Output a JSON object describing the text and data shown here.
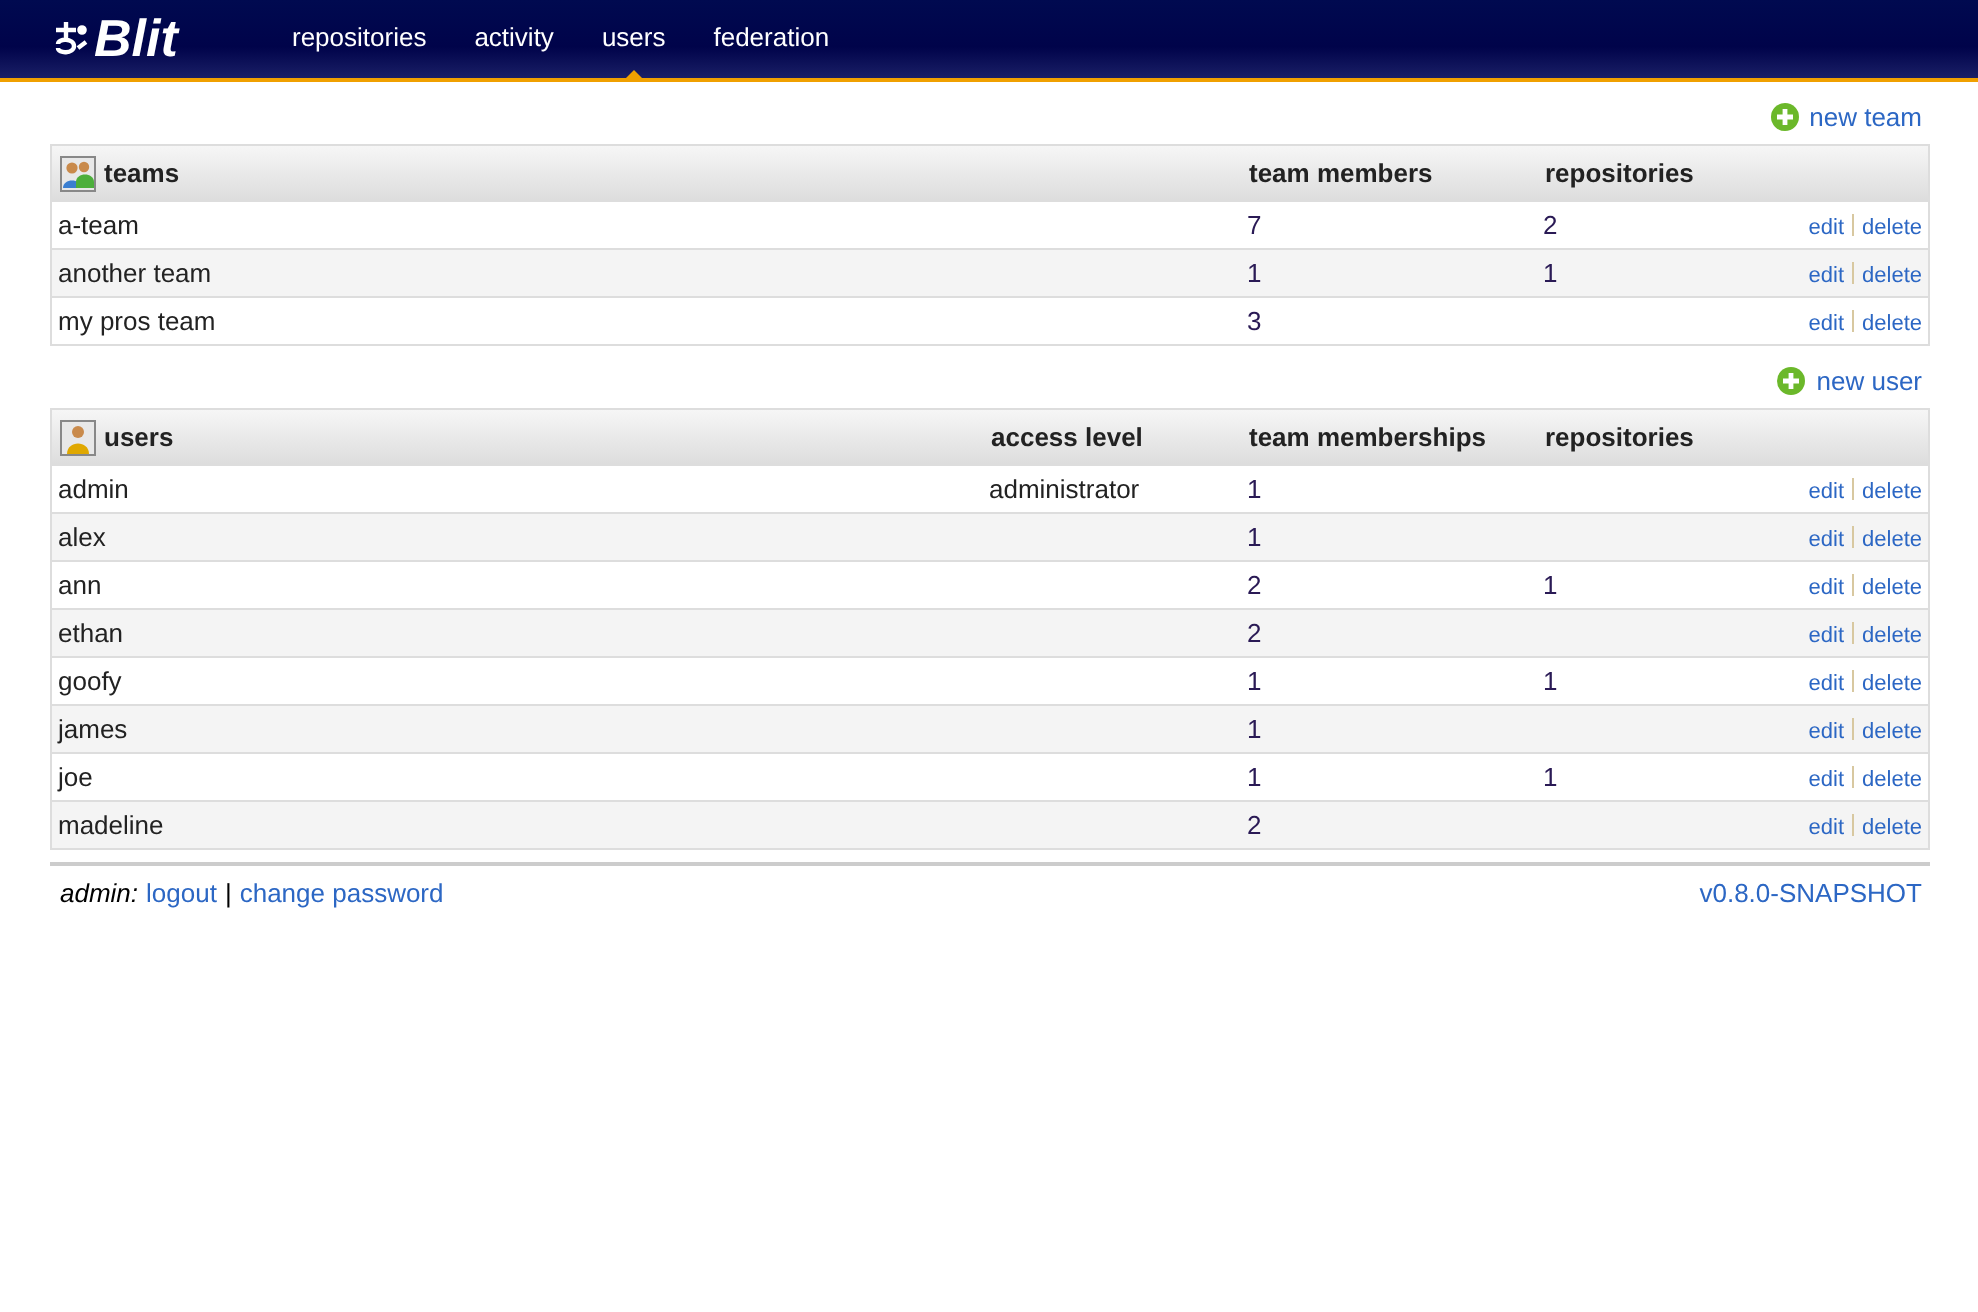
{
  "header": {
    "logo": "Blit",
    "nav": [
      {
        "label": "repositories",
        "selected": false
      },
      {
        "label": "activity",
        "selected": false
      },
      {
        "label": "users",
        "selected": true
      },
      {
        "label": "federation",
        "selected": false
      }
    ]
  },
  "teams": {
    "add_link": "new team",
    "columns": [
      "teams",
      "team members",
      "repositories"
    ],
    "rows": [
      {
        "name": "a-team",
        "members": "7",
        "repositories": "2",
        "actions": [
          "edit",
          "delete"
        ]
      },
      {
        "name": "another team",
        "members": "1",
        "repositories": "1",
        "actions": [
          "edit",
          "delete"
        ]
      },
      {
        "name": "my pros team",
        "members": "3",
        "repositories": "",
        "actions": [
          "edit",
          "delete"
        ]
      }
    ]
  },
  "users": {
    "add_link": "new user",
    "columns": [
      "users",
      "access level",
      "team memberships",
      "repositories"
    ],
    "rows": [
      {
        "name": "admin",
        "access_level": "administrator",
        "memberships": "1",
        "repositories": "",
        "actions": [
          "edit",
          "delete"
        ]
      },
      {
        "name": "alex",
        "access_level": "",
        "memberships": "1",
        "repositories": "",
        "actions": [
          "edit",
          "delete"
        ]
      },
      {
        "name": "ann",
        "access_level": "",
        "memberships": "2",
        "repositories": "1",
        "actions": [
          "edit",
          "delete"
        ]
      },
      {
        "name": "ethan",
        "access_level": "",
        "memberships": "2",
        "repositories": "",
        "actions": [
          "edit",
          "delete"
        ]
      },
      {
        "name": "goofy",
        "access_level": "",
        "memberships": "1",
        "repositories": "1",
        "actions": [
          "edit",
          "delete"
        ]
      },
      {
        "name": "james",
        "access_level": "",
        "memberships": "1",
        "repositories": "",
        "actions": [
          "edit",
          "delete"
        ]
      },
      {
        "name": "joe",
        "access_level": "",
        "memberships": "1",
        "repositories": "1",
        "actions": [
          "edit",
          "delete"
        ]
      },
      {
        "name": "madeline",
        "access_level": "",
        "memberships": "2",
        "repositories": "",
        "actions": [
          "edit",
          "delete"
        ]
      }
    ]
  },
  "footer": {
    "user": "admin:",
    "links": [
      "logout",
      "change password"
    ],
    "separator": "|",
    "version": "v0.8.0-SNAPSHOT"
  }
}
